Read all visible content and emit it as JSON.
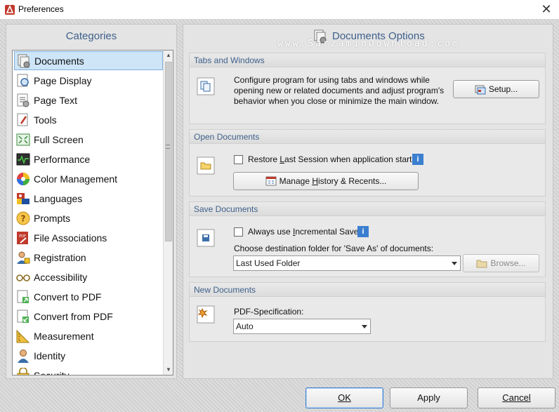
{
  "window": {
    "title": "Preferences"
  },
  "categories": {
    "header": "Categories",
    "items": [
      {
        "label": "Documents",
        "icon": "documents-icon",
        "selected": true
      },
      {
        "label": "Page Display",
        "icon": "page-display-icon"
      },
      {
        "label": "Page Text",
        "icon": "page-text-icon"
      },
      {
        "label": "Tools",
        "icon": "tools-icon"
      },
      {
        "label": "Full Screen",
        "icon": "full-screen-icon"
      },
      {
        "label": "Performance",
        "icon": "performance-icon"
      },
      {
        "label": "Color Management",
        "icon": "color-wheel-icon"
      },
      {
        "label": "Languages",
        "icon": "languages-icon"
      },
      {
        "label": "Prompts",
        "icon": "question-icon"
      },
      {
        "label": "File Associations",
        "icon": "pdf-file-icon"
      },
      {
        "label": "Registration",
        "icon": "registration-icon"
      },
      {
        "label": "Accessibility",
        "icon": "glasses-icon"
      },
      {
        "label": "Convert to PDF",
        "icon": "convert-to-pdf-icon"
      },
      {
        "label": "Convert from PDF",
        "icon": "convert-from-pdf-icon"
      },
      {
        "label": "Measurement",
        "icon": "ruler-icon"
      },
      {
        "label": "Identity",
        "icon": "identity-icon"
      },
      {
        "label": "Security",
        "icon": "security-icon"
      }
    ]
  },
  "options": {
    "header": "Documents Options",
    "watermark": "www.SarzaminDownload.com",
    "tabs_windows": {
      "title": "Tabs and Windows",
      "description": [
        "Configure program for using tabs and windows while",
        "opening new or related documents and adjust program's",
        "behavior when you close or minimize the main window."
      ],
      "setup_label": "Setup..."
    },
    "open_documents": {
      "title": "Open Documents",
      "restore_pre": "Restore ",
      "restore_key": "L",
      "restore_post": "ast Session when application starts",
      "manage_pre": "Manage ",
      "manage_key": "H",
      "manage_post": "istory & Recents..."
    },
    "save_documents": {
      "title": "Save Documents",
      "incremental_pre": "Always use ",
      "incremental_key": "I",
      "incremental_post": "ncremental Save",
      "destination_label": "Choose destination folder for 'Save As' of documents:",
      "destination_value": "Last Used Folder",
      "browse_label": "Browse..."
    },
    "new_documents": {
      "title": "New Documents",
      "spec_label": "PDF-Specification:",
      "spec_value": "Auto"
    }
  },
  "footer": {
    "ok": "OK",
    "apply": "Apply",
    "cancel": "Cancel"
  },
  "colors": {
    "accent": "#3d5f8a",
    "selection": "#cde5f7",
    "info": "#3c7fd0"
  }
}
